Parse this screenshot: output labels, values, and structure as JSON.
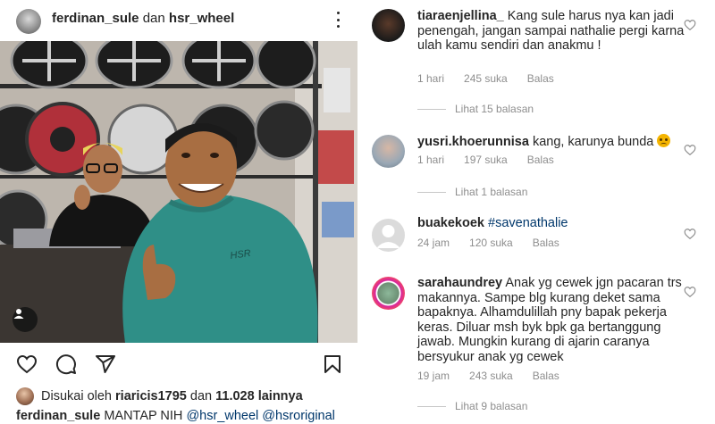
{
  "post": {
    "author": "ferdinan_sule",
    "joiner": "dan",
    "coauthor": "hsr_wheel",
    "likes_prefix": "Disukai oleh",
    "liked_by": "riaricis1795",
    "likes_and": "dan",
    "likes_count": "11.028 lainnya",
    "caption_user": "ferdinan_sule",
    "caption_text": "MANTAP NIH",
    "caption_mention_1": "@hsr_wheel",
    "caption_mention_2": "@hsroriginal",
    "photo_logo": "HSR"
  },
  "icons": {
    "more": "more-options-icon",
    "like": "heart-icon",
    "comment": "comment-icon",
    "share": "share-icon",
    "save": "bookmark-icon",
    "tag": "person-tag-icon"
  },
  "comments": [
    {
      "user": "tiaraenjellina_",
      "text": "Kang sule harus nya kan jadi penengah, jangan sampai nathalie pergi karna ulah kamu sendiri dan anakmu !",
      "time": "1 hari",
      "likes": "245 suka",
      "reply": "Balas",
      "view_replies": "Lihat 15 balasan"
    },
    {
      "user": "yusri.khoerunnisa",
      "text": "kang, karunya bunda",
      "time": "1 hari",
      "likes": "197 suka",
      "reply": "Balas",
      "view_replies": "Lihat 1 balasan"
    },
    {
      "user": "buakekoek",
      "text": "#savenathalie",
      "time": "24 jam",
      "likes": "120 suka",
      "reply": "Balas"
    },
    {
      "user": "sarahaundrey",
      "text": "Anak yg cewek jgn pacaran trs makannya. Sampe blg kurang deket sama bapaknya. Alhamdulillah pny bapak pekerja keras. Diluar msh byk bpk ga bertanggung jawab. Mungkin kurang di ajarin caranya bersyukur anak yg cewek",
      "time": "19 jam",
      "likes": "243 suka",
      "reply": "Balas",
      "view_replies": "Lihat 9 balasan"
    }
  ],
  "colors": {
    "text": "#262626",
    "muted": "#8e8e8e",
    "link": "#00376b",
    "shirt_teal": "#2f8f87"
  }
}
